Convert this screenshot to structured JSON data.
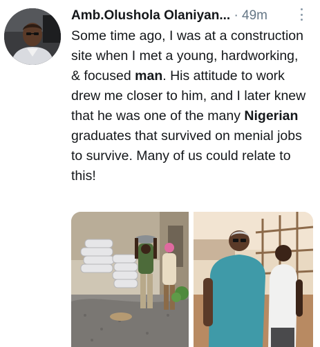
{
  "tweet": {
    "author_name": "Amb.Olushola Olaniyan...",
    "separator": "·",
    "timestamp": "49m",
    "text_parts": [
      "Some time ago, I was at a construction site when I met a young, hardworking, & focused ",
      "man",
      ". His attitude to work drew me closer to him, and I later knew that he was one of the many ",
      "Nigerian",
      " graduates that survived on menial jobs to survive. Many of us could relate to this!"
    ]
  },
  "icons": {
    "more": "more-vertical-icon"
  },
  "colors": {
    "text": "#14171a",
    "meta": "#657786",
    "background": "#ffffff"
  }
}
